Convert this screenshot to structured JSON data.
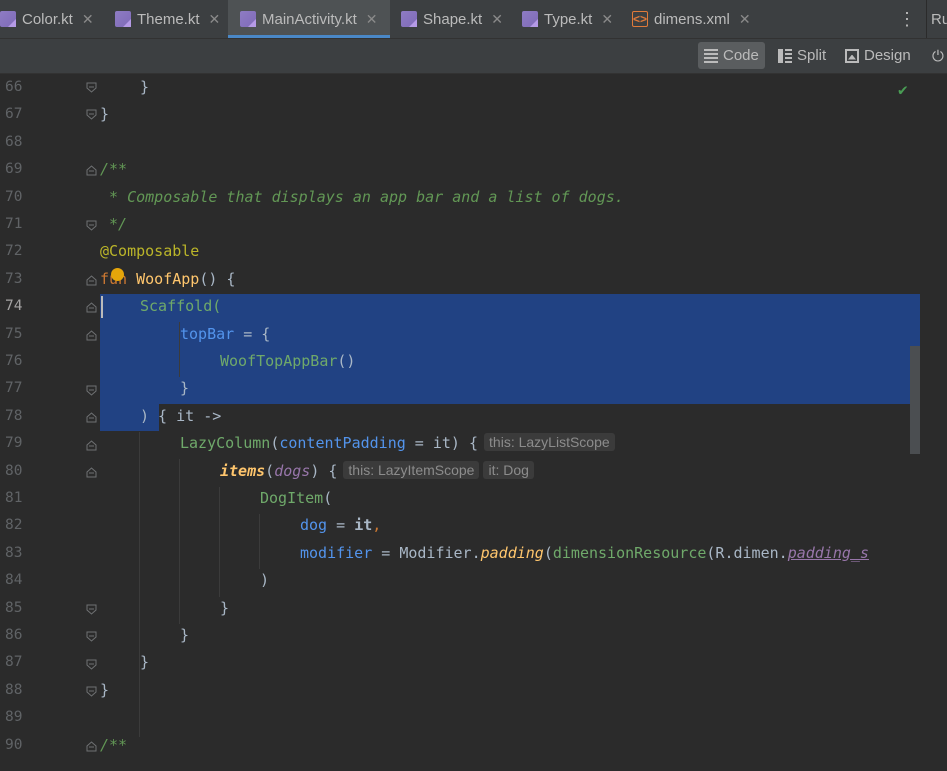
{
  "tabs": [
    {
      "label": "Color.kt",
      "icon": "kotlin-file-icon",
      "active": false
    },
    {
      "label": "Theme.kt",
      "icon": "kotlin-file-icon",
      "active": false
    },
    {
      "label": "MainActivity.kt",
      "icon": "kotlin-file-icon",
      "active": true
    },
    {
      "label": "Shape.kt",
      "icon": "kotlin-file-icon",
      "active": false
    },
    {
      "label": "Type.kt",
      "icon": "kotlin-file-icon",
      "active": false
    },
    {
      "label": "dimens.xml",
      "icon": "xml-file-icon",
      "active": false
    }
  ],
  "right_panel_label": "Ru",
  "view_modes": [
    {
      "label": "Code",
      "selected": true
    },
    {
      "label": "Split",
      "selected": false
    },
    {
      "label": "Design",
      "selected": false
    }
  ],
  "editor": {
    "current_line": "74",
    "line_numbers": [
      "66",
      "67",
      "68",
      "69",
      "70",
      "71",
      "72",
      "73",
      "74",
      "75",
      "76",
      "77",
      "78",
      "79",
      "80",
      "81",
      "82",
      "83",
      "84",
      "85",
      "86",
      "87",
      "88",
      "89",
      "90"
    ],
    "code": {
      "l66": "}",
      "l67": "}",
      "l69": "/**",
      "l70": " * Composable that displays an app bar and a list of dogs.",
      "l71": " */",
      "l72": "@Composable",
      "l73_kw": "fun",
      "l73_name": "WoofApp",
      "l73_rest": "() {",
      "l74_call": "Scaffold",
      "l74_rest": "(",
      "l75_param": "topBar",
      "l75_rest": " = {",
      "l76_call": "WoofTopAppBar",
      "l76_rest": "()",
      "l77": "}",
      "l78_a": ") { ",
      "l78_it": "it",
      "l78_b": " ->",
      "l79_call": "LazyColumn",
      "l79_a": "(",
      "l79_param": "contentPadding",
      "l79_b": " = it) {",
      "l79_hint": "this: LazyListScope",
      "l80_fn": "items",
      "l80_a": "(",
      "l80_arg": "dogs",
      "l80_b": ") {",
      "l80_hint1": "this: LazyItemScope",
      "l80_hint2": "it: Dog",
      "l81_call": "DogItem",
      "l81_rest": "(",
      "l82_param": "dog",
      "l82_eq": " = ",
      "l82_it": "it",
      "l82_comma": ",",
      "l83_param": "modifier",
      "l83_a": " = Modifier.",
      "l83_ext": "padding",
      "l83_b": "(",
      "l83_call": "dimensionResource",
      "l83_c": "(R.dimen.",
      "l83_prop": "padding_s",
      "l84": ")",
      "l85": "}",
      "l86": "}",
      "l87": "}",
      "l88": "}",
      "l90": "/**"
    }
  },
  "colors": {
    "background": "#2b2b2b",
    "selection": "#214283",
    "keyword": "#cc7832",
    "function_decl": "#ffc66d",
    "composable_call": "#6fa96a",
    "named_param": "#5394ec",
    "annotation": "#bbb529",
    "doc_comment": "#629755",
    "property": "#9876aa"
  }
}
